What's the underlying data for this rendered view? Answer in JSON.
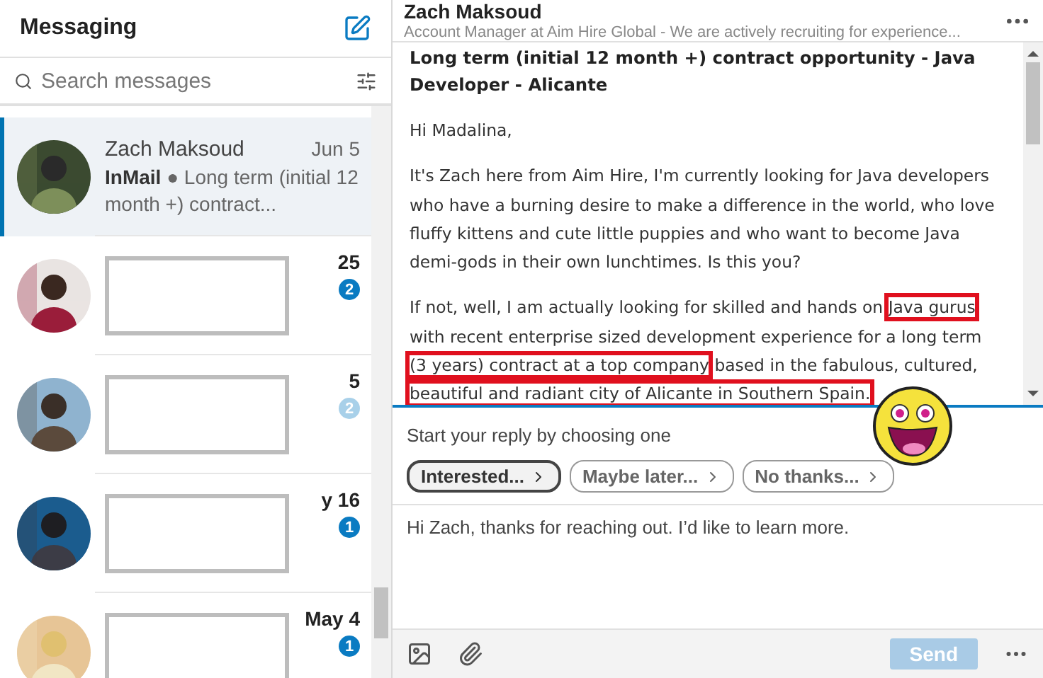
{
  "sidebar": {
    "title": "Messaging",
    "search": {
      "placeholder": "Search messages"
    },
    "conversations": [
      {
        "kind": "visible",
        "selected": true,
        "name": "Zach Maksoud",
        "date": "Jun 5",
        "tag": "InMail",
        "separator": "●",
        "preview": "Long term (initial 12 month +) contract..."
      },
      {
        "kind": "redacted",
        "selected": false,
        "date": "25",
        "badge": "2",
        "badge_faded": false
      },
      {
        "kind": "redacted",
        "selected": false,
        "date": "5",
        "badge": "2",
        "badge_faded": true
      },
      {
        "kind": "redacted",
        "selected": false,
        "date": "y 16",
        "badge": "1",
        "badge_faded": false
      },
      {
        "kind": "redacted",
        "selected": false,
        "date": "May 4",
        "badge": "1",
        "badge_faded": false
      }
    ]
  },
  "thread": {
    "name": "Zach Maksoud",
    "headline": "Account Manager at Aim Hire Global - We are actively recruiting for experience...",
    "subject": "Long term (initial 12 month +) contract opportunity - Java Developer - Alicante",
    "paragraphs": [
      [
        {
          "text": "Hi Madalina,",
          "highlighted": false
        }
      ],
      [
        {
          "text": "It's Zach here from Aim Hire, I'm currently looking for Java developers who have a burning desire to make a difference in the world, who love fluffy kittens and cute little puppies and who want to become Java demi-gods in their own lunchtimes. Is this you?",
          "highlighted": false
        }
      ],
      [
        {
          "text": "If not, well, I am actually looking for skilled and hands on ",
          "highlighted": false
        },
        {
          "text": "Java gurus",
          "highlighted": true
        },
        {
          "text": " with recent enterprise sized development experience for a long term ",
          "highlighted": false
        },
        {
          "text": "(3 years) contract at a top company",
          "highlighted": true
        },
        {
          "text": " based in the fabulous, cultured, ",
          "highlighted": false
        },
        {
          "text": "beautiful and radiant city of Alicante in Southern Spain.",
          "highlighted": true
        }
      ]
    ],
    "reply_prompt": "Start your reply by choosing one",
    "quick_replies": [
      {
        "label": "Interested...",
        "selected": true
      },
      {
        "label": "Maybe later...",
        "selected": false
      },
      {
        "label": "No thanks...",
        "selected": false
      }
    ],
    "reply_text": "Hi Zach, thanks for reaching out. I’d like to learn more.",
    "send": {
      "label": "Send",
      "disabled": true
    }
  }
}
